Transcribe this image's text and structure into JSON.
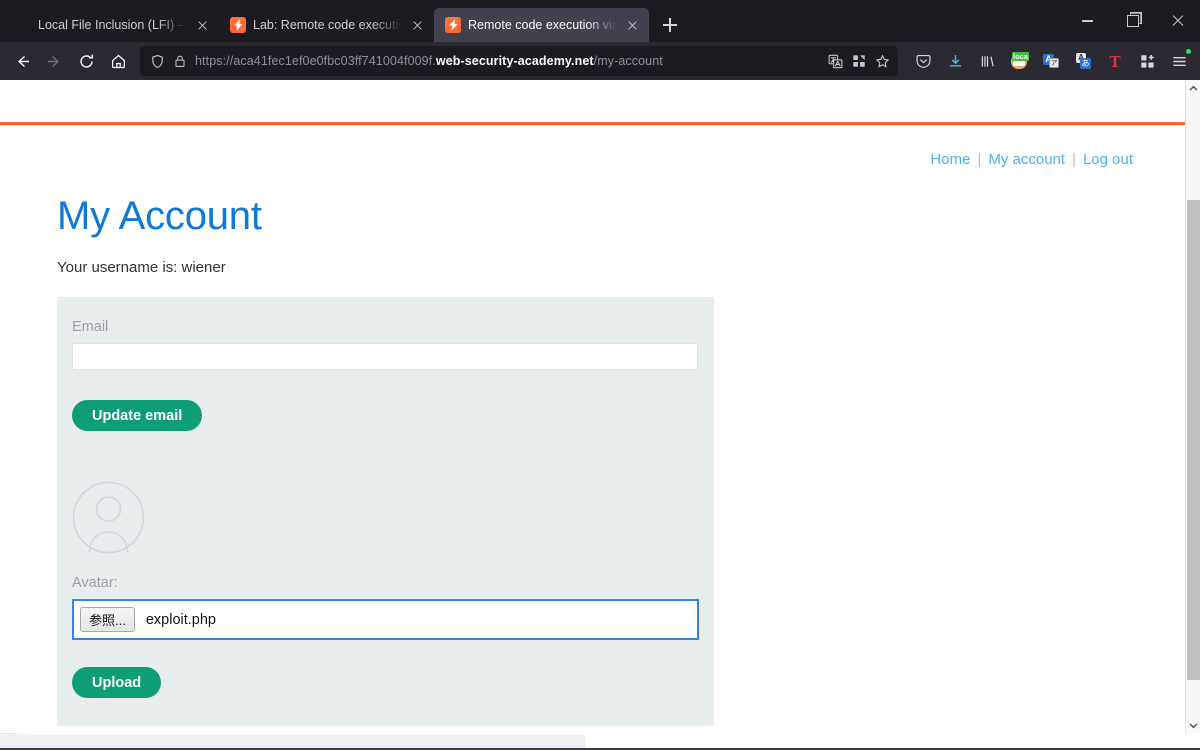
{
  "browser": {
    "tabs": [
      {
        "title": "Local File Inclusion (LFI) — Web App",
        "favicon": "blank",
        "active": false
      },
      {
        "title": "Lab: Remote code execution via",
        "favicon": "portswigger-icon",
        "active": false
      },
      {
        "title": "Remote code execution via web",
        "favicon": "portswigger-icon",
        "active": true
      }
    ],
    "new_tab_label": "+",
    "window_controls": {
      "minimize": "minimize-icon",
      "maximize": "restore-icon",
      "close": "close-icon"
    },
    "nav": {
      "back": "back-arrow-icon",
      "forward": "forward-arrow-icon",
      "reload": "reload-icon",
      "home": "home-icon"
    },
    "url": {
      "scheme_path_prefix": "https://aca41fec1ef0e0fbc03ff741004f009f.",
      "host": "web-security-academy.net",
      "path": "/my-account",
      "shield_icon": "tracking-shield-icon",
      "lock_icon": "padlock-icon",
      "translate_icon": "translate-page-icon",
      "reader_icon": "reader-mode-icon",
      "bookmark_icon": "star-bookmark-icon"
    },
    "extensions": [
      {
        "name": "pocket-icon",
        "glyph": "pocket"
      },
      {
        "name": "downloads-icon",
        "glyph": "download"
      },
      {
        "name": "library-icon",
        "glyph": "library"
      },
      {
        "name": "localhost-extension-icon",
        "glyph": "loca"
      },
      {
        "name": "translator-extension-icon",
        "glyph": "A"
      },
      {
        "name": "japanese-translate-extension-icon",
        "glyph": "あ"
      },
      {
        "name": "tampermonkey-icon",
        "glyph": "T"
      },
      {
        "name": "extensions-icon",
        "glyph": "puzzle"
      },
      {
        "name": "app-menu-icon",
        "glyph": "hamburger"
      }
    ]
  },
  "page": {
    "accent_bar_color": "#ff6633",
    "nav_links": [
      {
        "label": "Home"
      },
      {
        "label": "My account"
      },
      {
        "label": "Log out"
      }
    ],
    "nav_separator": "|",
    "title": "My Account",
    "username_line": "Your username is: wiener",
    "form": {
      "email_label": "Email",
      "email_value": "",
      "email_placeholder": "",
      "update_email_button": "Update email",
      "avatar_icon": "user-avatar-placeholder-icon",
      "avatar_label": "Avatar:",
      "file_browse_button": "参照...",
      "file_name": "exploit.php",
      "upload_button": "Upload"
    },
    "colors": {
      "title_blue": "#0d7ad9",
      "link_blue": "#4ab3f4",
      "panel_bg": "#e8edee",
      "button_green": "#0e9e76",
      "focus_border": "#3584e4"
    }
  }
}
